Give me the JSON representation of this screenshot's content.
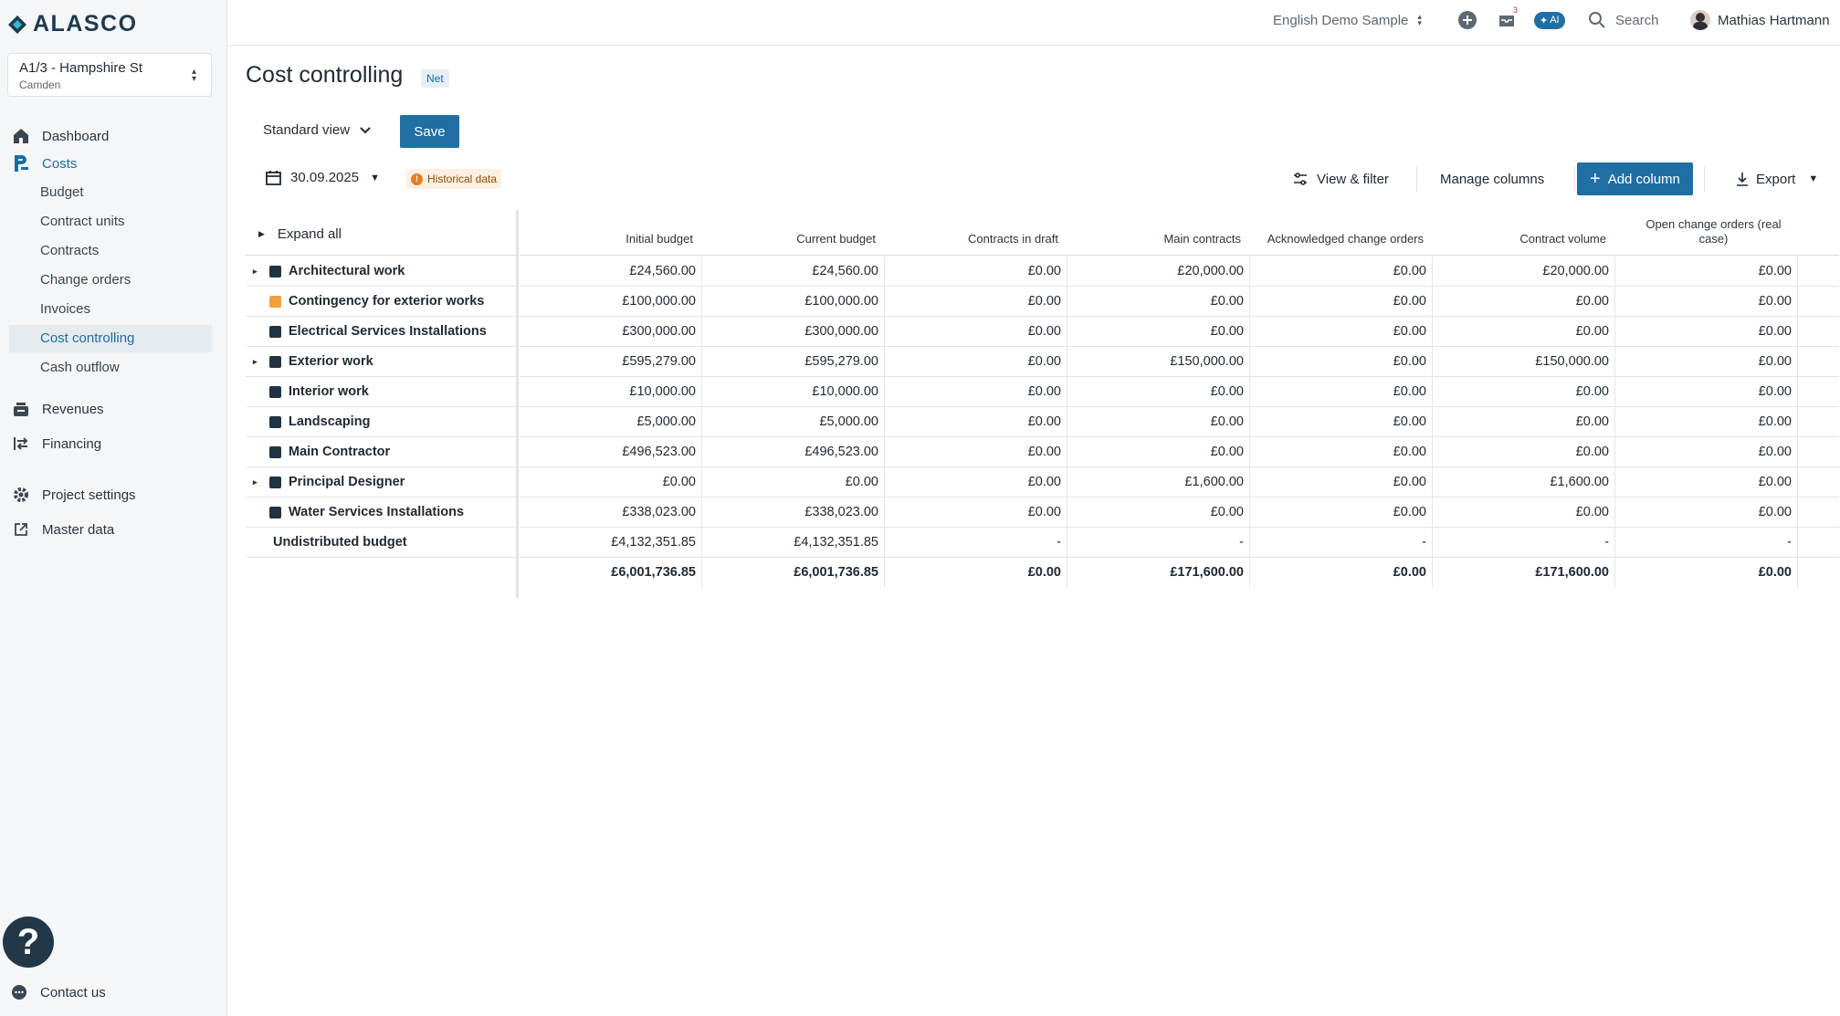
{
  "app": {
    "logo_text": "ALASCO"
  },
  "project": {
    "name": "A1/3 - Hampshire St",
    "subtitle": "Camden"
  },
  "nav": {
    "dashboard": "Dashboard",
    "costs": "Costs",
    "costs_sub": [
      "Budget",
      "Contract units",
      "Contracts",
      "Change orders",
      "Invoices",
      "Cost controlling",
      "Cash outflow"
    ],
    "revenues": "Revenues",
    "financing": "Financing",
    "project_settings": "Project settings",
    "master_data": "Master data"
  },
  "help": {
    "label": "?"
  },
  "contact": {
    "label": "Contact us"
  },
  "topbar": {
    "workspace": "English Demo Sample",
    "notification_count": "3",
    "ai_label": "AI",
    "search_label": "Search",
    "user_name": "Mathias Hartmann"
  },
  "page": {
    "title": "Cost controlling",
    "badge": "Net"
  },
  "toolbar": {
    "view_label": "Standard view",
    "save_label": "Save",
    "date": "30.09.2025",
    "historical_label": "Historical data",
    "view_filter_label": "View & filter",
    "manage_columns_label": "Manage columns",
    "add_column_label": "Add column",
    "export_label": "Export"
  },
  "table": {
    "expand_all": "Expand all",
    "columns": [
      "Initial budget",
      "Current budget",
      "Contracts in draft",
      "Main contracts",
      "Acknowledged change orders",
      "Contract volume",
      "Open change orders (real case)"
    ],
    "rows": [
      {
        "name": "Architectural work",
        "expandable": true,
        "color": "#1f3343",
        "values": [
          "£24,560.00",
          "£24,560.00",
          "£0.00",
          "£20,000.00",
          "£0.00",
          "£20,000.00",
          "£0.00"
        ]
      },
      {
        "name": "Contingency for exterior works",
        "expandable": false,
        "color": "#f2a03d",
        "values": [
          "£100,000.00",
          "£100,000.00",
          "£0.00",
          "£0.00",
          "£0.00",
          "£0.00",
          "£0.00"
        ]
      },
      {
        "name": "Electrical Services Installations",
        "expandable": false,
        "color": "#1f3343",
        "values": [
          "£300,000.00",
          "£300,000.00",
          "£0.00",
          "£0.00",
          "£0.00",
          "£0.00",
          "£0.00"
        ]
      },
      {
        "name": "Exterior work",
        "expandable": true,
        "color": "#1f3343",
        "values": [
          "£595,279.00",
          "£595,279.00",
          "£0.00",
          "£150,000.00",
          "£0.00",
          "£150,000.00",
          "£0.00"
        ]
      },
      {
        "name": "Interior work",
        "expandable": false,
        "color": "#1f3343",
        "values": [
          "£10,000.00",
          "£10,000.00",
          "£0.00",
          "£0.00",
          "£0.00",
          "£0.00",
          "£0.00"
        ]
      },
      {
        "name": "Landscaping",
        "expandable": false,
        "color": "#1f3343",
        "values": [
          "£5,000.00",
          "£5,000.00",
          "£0.00",
          "£0.00",
          "£0.00",
          "£0.00",
          "£0.00"
        ]
      },
      {
        "name": "Main Contractor",
        "expandable": false,
        "color": "#1f3343",
        "values": [
          "£496,523.00",
          "£496,523.00",
          "£0.00",
          "£0.00",
          "£0.00",
          "£0.00",
          "£0.00"
        ]
      },
      {
        "name": "Principal Designer",
        "expandable": true,
        "color": "#1f3343",
        "values": [
          "£0.00",
          "£0.00",
          "£0.00",
          "£1,600.00",
          "£0.00",
          "£1,600.00",
          "£0.00"
        ]
      },
      {
        "name": "Water Services Installations",
        "expandable": false,
        "color": "#1f3343",
        "values": [
          "£338,023.00",
          "£338,023.00",
          "£0.00",
          "£0.00",
          "£0.00",
          "£0.00",
          "£0.00"
        ]
      },
      {
        "name": "Undistributed budget",
        "expandable": false,
        "color": "",
        "values": [
          "£4,132,351.85",
          "£4,132,351.85",
          "-",
          "-",
          "-",
          "-",
          "-"
        ]
      }
    ],
    "totals": [
      "£6,001,736.85",
      "£6,001,736.85",
      "£0.00",
      "£171,600.00",
      "£0.00",
      "£171,600.00",
      "£0.00"
    ]
  }
}
